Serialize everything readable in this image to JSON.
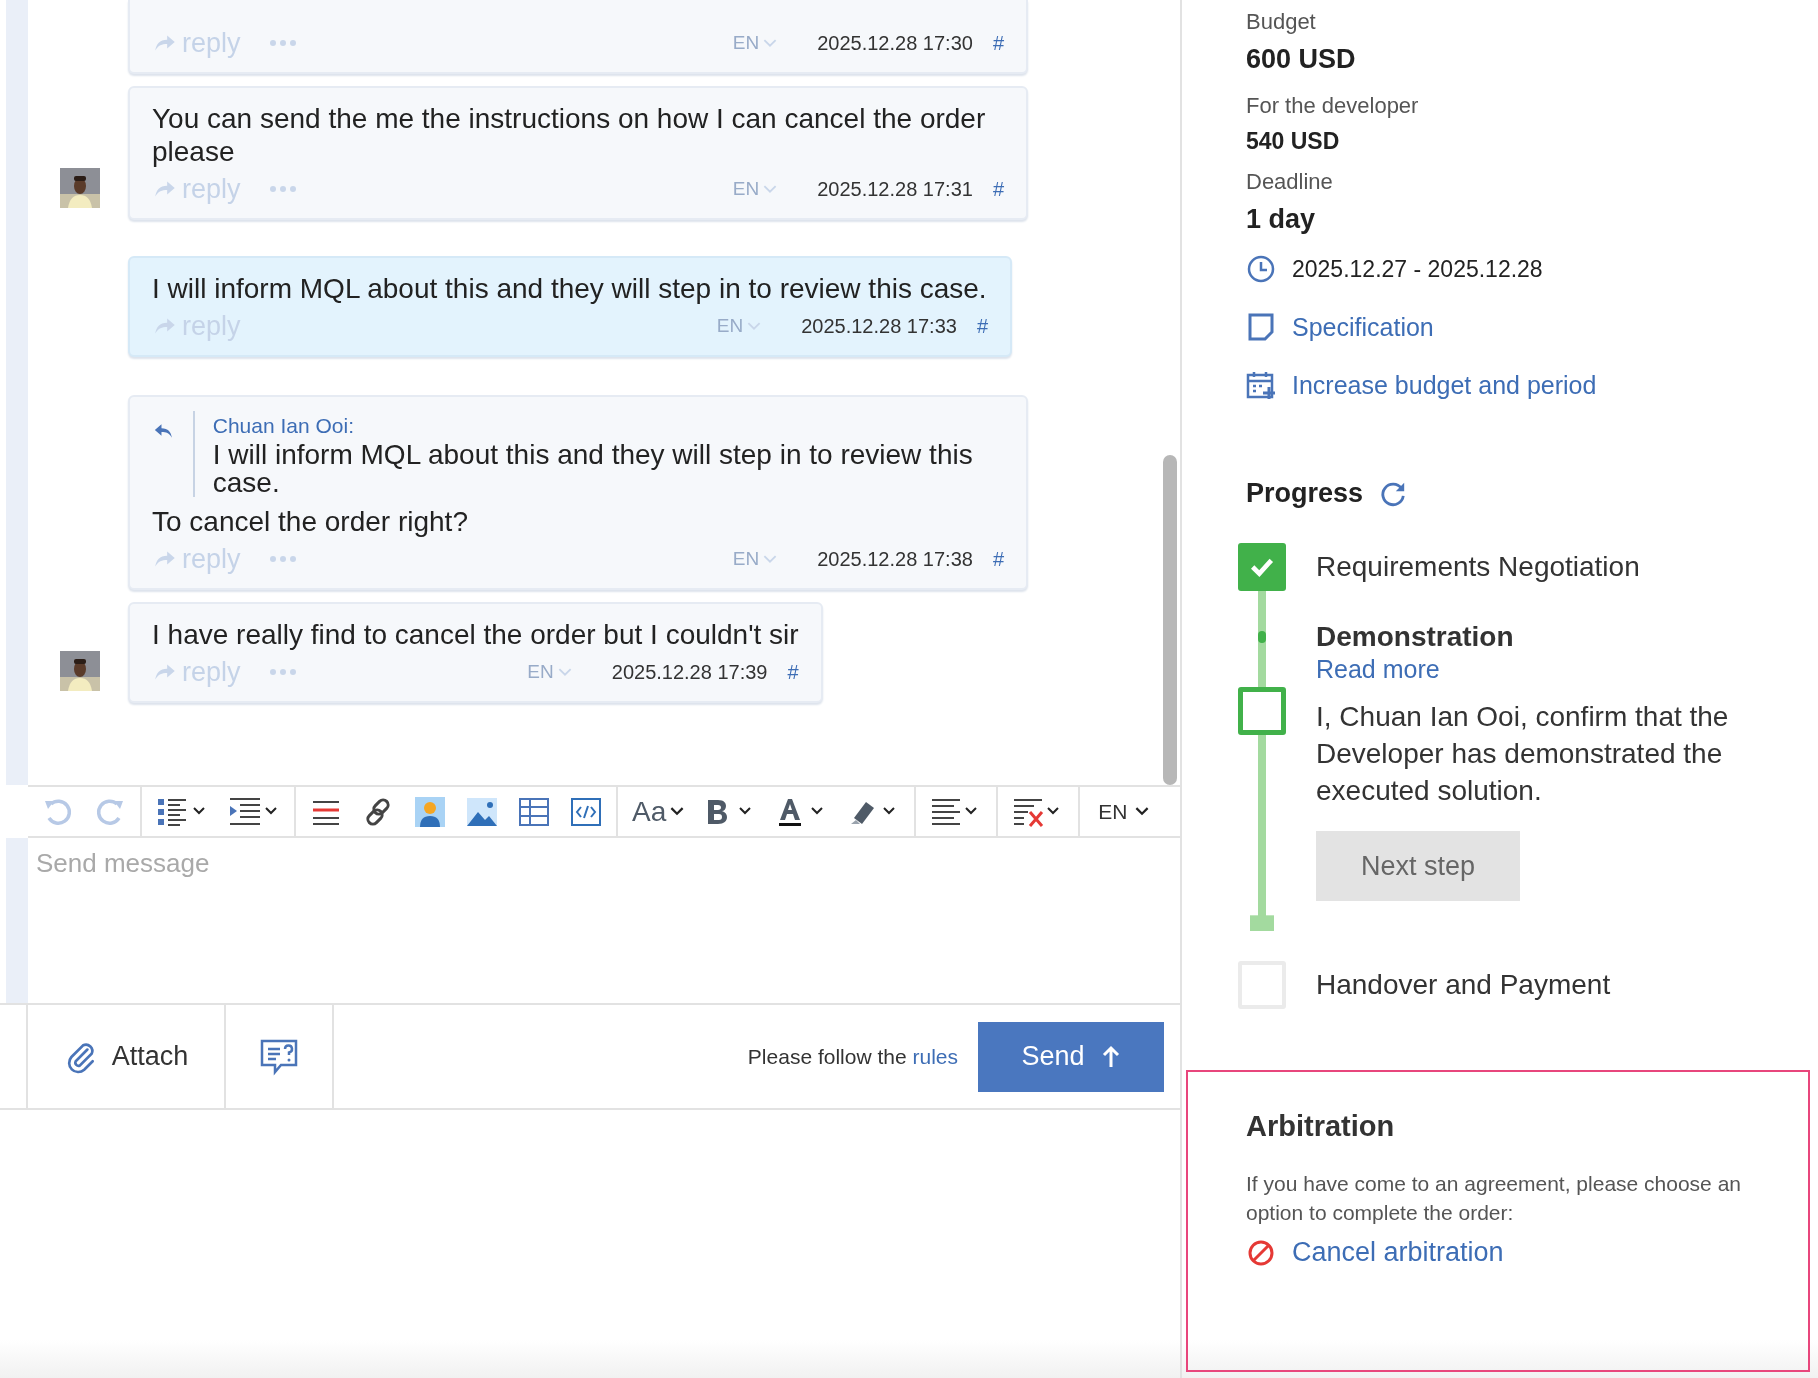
{
  "chat": {
    "messages": [
      {
        "kind": "incoming",
        "avatar": false,
        "reply": "reply",
        "more": true,
        "lang": "EN",
        "time": "2025.12.28 17:30",
        "anchor": "#"
      },
      {
        "kind": "incoming",
        "text": "You can send the me the instructions on how I can cancel the order please",
        "avatar": true,
        "reply": "reply",
        "more": true,
        "lang": "EN",
        "time": "2025.12.28 17:31",
        "anchor": "#"
      },
      {
        "kind": "own",
        "text": "I will inform MQL about this and they will step in to review this case.",
        "avatar": false,
        "reply": "reply",
        "more": false,
        "lang": "EN",
        "time": "2025.12.28 17:33",
        "anchor": "#"
      },
      {
        "kind": "incoming",
        "quote": {
          "author": "Chuan Ian Ooi:",
          "text": "I will inform MQL about this and they will step in to review this case."
        },
        "text": "To cancel the order right?",
        "avatar": false,
        "reply": "reply",
        "more": true,
        "lang": "EN",
        "time": "2025.12.28 17:38",
        "anchor": "#"
      },
      {
        "kind": "incoming",
        "text": "I have really find to cancel the order but I couldn't sir",
        "avatar": true,
        "reply": "reply",
        "more": true,
        "lang": "EN",
        "time": "2025.12.28 17:39",
        "anchor": "#"
      }
    ]
  },
  "editor": {
    "font_label": "Aa",
    "language": "EN",
    "placeholder": "Send message"
  },
  "footer": {
    "attach": "Attach",
    "rules_prefix": "Please follow the",
    "rules_link": "rules",
    "send": "Send"
  },
  "order": {
    "budget_label": "Budget",
    "budget": "600 USD",
    "developer_label": "For the developer",
    "developer_amount": "540 USD",
    "deadline_label": "Deadline",
    "deadline": "1 day",
    "dates": "2025.12.27 - 2025.12.28",
    "specification": "Specification",
    "increase": "Increase budget and period"
  },
  "progress": {
    "title": "Progress",
    "steps": [
      {
        "kind": "done",
        "title": "Requirements Negotiation",
        "checked": true
      },
      {
        "kind": "current",
        "title": "Demonstration",
        "link": "Read more",
        "confirm": "I, Chuan Ian Ooi, confirm that the Developer has demonstrated the executed solution.",
        "checked": false,
        "button": "Next step",
        "disabled": true
      },
      {
        "kind": "pending",
        "title": "Handover and Payment",
        "checked": false
      }
    ]
  },
  "arbitration": {
    "title": "Arbitration",
    "text": "If you have come to an agreement, please choose an option to complete the order:",
    "action": "Cancel arbitration"
  }
}
